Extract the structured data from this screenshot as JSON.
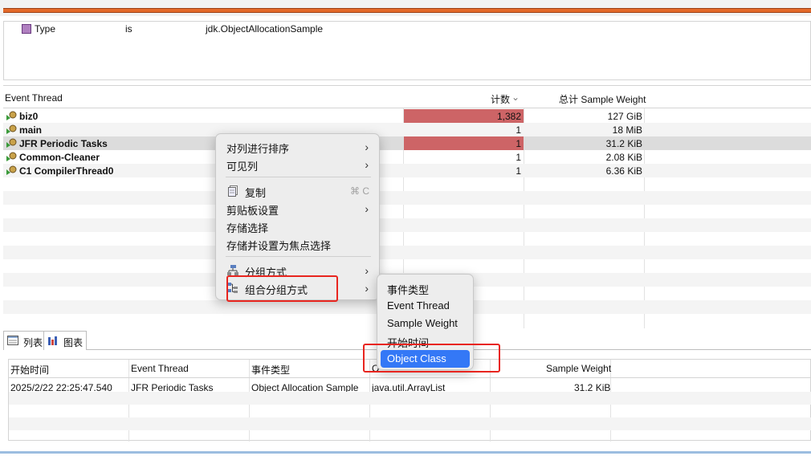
{
  "filter": {
    "field": "Type",
    "operator": "is",
    "value": "jdk.ObjectAllocationSample"
  },
  "main_table": {
    "columns": [
      "Event Thread",
      "计数",
      "总计 Sample Weight"
    ],
    "sort_indicator": "⌄",
    "rows": [
      {
        "thread": "biz0",
        "count": "1,382",
        "weight": "127 GiB"
      },
      {
        "thread": "main",
        "count": "1",
        "weight": "18 MiB"
      },
      {
        "thread": "JFR Periodic Tasks",
        "count": "1",
        "weight": "31.2 KiB"
      },
      {
        "thread": "Common-Cleaner",
        "count": "1",
        "weight": "2.08 KiB"
      },
      {
        "thread": "C1 CompilerThread0",
        "count": "1",
        "weight": "6.36 KiB"
      }
    ]
  },
  "tabs": {
    "list": "列表",
    "chart": "图表"
  },
  "detail_table": {
    "columns": [
      "开始时间",
      "Event Thread",
      "事件类型",
      "O",
      "Sample Weight"
    ],
    "rows": [
      {
        "start": "2025/2/22 22:25:47.540",
        "thread": "JFR Periodic Tasks",
        "type": "Object Allocation Sample",
        "class": "java.util.ArrayList",
        "weight": "31.2 KiB"
      }
    ]
  },
  "context_menu": {
    "sort": "对列进行排序",
    "visible": "可见列",
    "copy": "复制",
    "copy_shortcut": "⌘ C",
    "clipboard": "剪贴板设置",
    "store": "存储选择",
    "store_focus": "存储并设置为焦点选择",
    "group_by": "分组方式",
    "combined_group_by": "组合分组方式",
    "arrow": "›"
  },
  "submenu": {
    "items": [
      "事件类型",
      "Event Thread",
      "Sample Weight",
      "开始时间",
      "Object Class"
    ],
    "selected": "Object Class"
  },
  "colors": {
    "count_highlight": "#cd6466",
    "menu_highlight": "#3478f6",
    "annotation": "#e8251f",
    "progress": "#e46a2a"
  }
}
